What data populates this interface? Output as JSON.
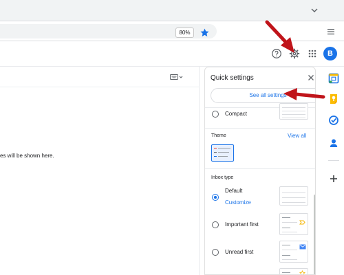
{
  "browser": {
    "zoom_level": "80%",
    "tab_list_icon": "chevron-down-icon",
    "bookmark_icon": "star-icon",
    "menu_icon": "hamburger-menu-icon",
    "accent_color": "#1a73e8"
  },
  "header": {
    "help_icon": "help-icon",
    "settings_icon": "gear-icon",
    "apps_icon": "apps-grid-icon",
    "avatar_initial": "B"
  },
  "main": {
    "input_tools_icon": "keyboard-icon",
    "empty_message": "es will be shown here."
  },
  "quick_settings": {
    "title": "Quick settings",
    "close_icon": "close-icon",
    "see_all_label": "See all settings",
    "density_options": [
      {
        "label": "Compact",
        "selected": false
      }
    ],
    "theme": {
      "title": "Theme",
      "view_all_label": "View all"
    },
    "inbox_type": {
      "title": "Inbox type",
      "options": [
        {
          "label": "Default",
          "selected": true,
          "action_label": "Customize"
        },
        {
          "label": "Important first",
          "selected": false
        },
        {
          "label": "Unread first",
          "selected": false
        }
      ]
    }
  },
  "side_rail": {
    "icons": [
      "calendar-icon",
      "keep-icon",
      "tasks-icon",
      "contacts-icon",
      "add-icon"
    ]
  },
  "annotations": {
    "arrow_color": "#c0141a"
  }
}
